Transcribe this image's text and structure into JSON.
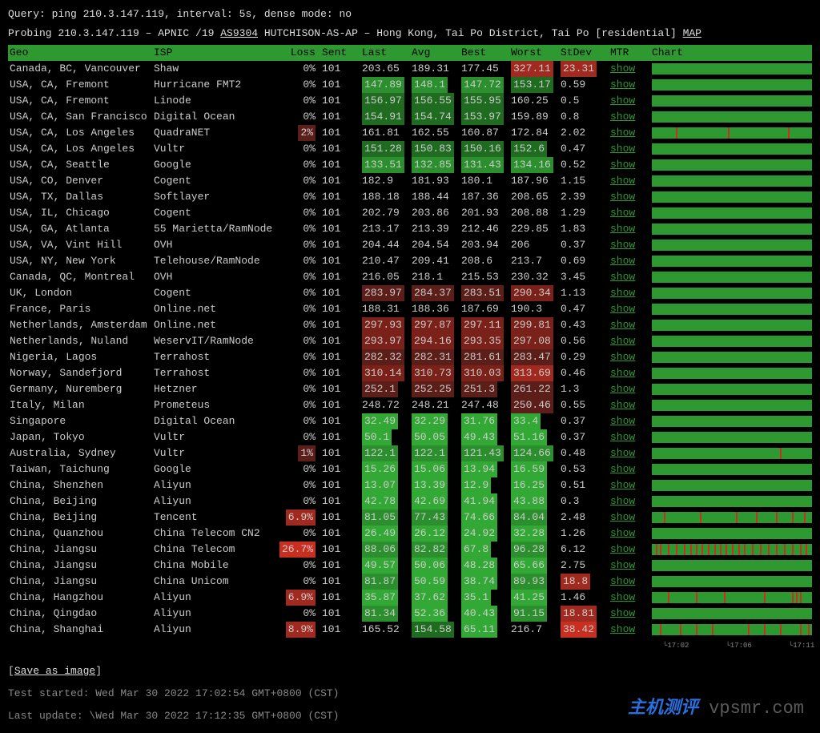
{
  "query_line": "Query: ping 210.3.147.119, interval: 5s, dense mode: no",
  "probe": {
    "prefix": "Probing 210.3.147.119 – APNIC /19 ",
    "asn": "AS9304",
    "mid": " HUTCHISON-AS-AP – Hong Kong, Tai Po District, Tai Po [residential] ",
    "map": "MAP"
  },
  "headers": {
    "geo": "Geo",
    "isp": "ISP",
    "loss": "Loss",
    "sent": "Sent",
    "last": "Last",
    "avg": "Avg",
    "best": "Best",
    "worst": "Worst",
    "stdev": "StDev",
    "mtr": "MTR",
    "chart": "Chart"
  },
  "mtr_label": "show",
  "rows": [
    {
      "geo": "Canada, BC, Vancouver",
      "isp": "Shaw",
      "loss": "0%",
      "lossc": "",
      "sent": "101",
      "last": "203.65",
      "lastc": "",
      "avg": "189.31",
      "avgc": "",
      "best": "177.45",
      "bestc": "",
      "worst": "327.11",
      "worstc": "r3",
      "stdev": "23.31",
      "stdevc": "r3",
      "ticks": []
    },
    {
      "geo": "USA, CA, Fremont",
      "isp": "Hurricane FMT2",
      "loss": "0%",
      "lossc": "",
      "sent": "101",
      "last": "147.89",
      "lastc": "g2",
      "avg": "148.1",
      "avgc": "g2",
      "best": "147.72",
      "bestc": "g2",
      "worst": "153.17",
      "worstc": "g1",
      "stdev": "0.59",
      "stdevc": "",
      "ticks": []
    },
    {
      "geo": "USA, CA, Fremont",
      "isp": "Linode",
      "loss": "0%",
      "lossc": "",
      "sent": "101",
      "last": "156.97",
      "lastc": "g1",
      "avg": "156.55",
      "avgc": "g1",
      "best": "155.95",
      "bestc": "g1",
      "worst": "160.25",
      "worstc": "",
      "stdev": "0.5",
      "stdevc": "",
      "ticks": []
    },
    {
      "geo": "USA, CA, San Francisco",
      "isp": "Digital Ocean",
      "loss": "0%",
      "lossc": "",
      "sent": "101",
      "last": "154.91",
      "lastc": "g1",
      "avg": "154.74",
      "avgc": "g1",
      "best": "153.97",
      "bestc": "g1",
      "worst": "159.89",
      "worstc": "",
      "stdev": "0.8",
      "stdevc": "",
      "ticks": []
    },
    {
      "geo": "USA, CA, Los Angeles",
      "isp": "QuadraNET",
      "loss": "2%",
      "lossc": "r1",
      "sent": "101",
      "last": "161.81",
      "lastc": "",
      "avg": "162.55",
      "avgc": "",
      "best": "160.87",
      "bestc": "",
      "worst": "172.84",
      "worstc": "",
      "stdev": "2.02",
      "stdevc": "",
      "ticks": [
        30,
        95,
        170
      ]
    },
    {
      "geo": "USA, CA, Los Angeles",
      "isp": "Vultr",
      "loss": "0%",
      "lossc": "",
      "sent": "101",
      "last": "151.28",
      "lastc": "g1",
      "avg": "150.83",
      "avgc": "g1",
      "best": "150.16",
      "bestc": "g1",
      "worst": "152.6",
      "worstc": "g1",
      "stdev": "0.47",
      "stdevc": "",
      "ticks": []
    },
    {
      "geo": "USA, CA, Seattle",
      "isp": "Google",
      "loss": "0%",
      "lossc": "",
      "sent": "101",
      "last": "133.51",
      "lastc": "g2",
      "avg": "132.85",
      "avgc": "g2",
      "best": "131.43",
      "bestc": "g2",
      "worst": "134.16",
      "worstc": "g2",
      "stdev": "0.52",
      "stdevc": "",
      "ticks": []
    },
    {
      "geo": "USA, CO, Denver",
      "isp": "Cogent",
      "loss": "0%",
      "lossc": "",
      "sent": "101",
      "last": "182.9",
      "lastc": "",
      "avg": "181.93",
      "avgc": "",
      "best": "180.1",
      "bestc": "",
      "worst": "187.96",
      "worstc": "",
      "stdev": "1.15",
      "stdevc": "",
      "ticks": []
    },
    {
      "geo": "USA, TX, Dallas",
      "isp": "Softlayer",
      "loss": "0%",
      "lossc": "",
      "sent": "101",
      "last": "188.18",
      "lastc": "",
      "avg": "188.44",
      "avgc": "",
      "best": "187.36",
      "bestc": "",
      "worst": "208.65",
      "worstc": "",
      "stdev": "2.39",
      "stdevc": "",
      "ticks": []
    },
    {
      "geo": "USA, IL, Chicago",
      "isp": "Cogent",
      "loss": "0%",
      "lossc": "",
      "sent": "101",
      "last": "202.79",
      "lastc": "",
      "avg": "203.86",
      "avgc": "",
      "best": "201.93",
      "bestc": "",
      "worst": "208.88",
      "worstc": "",
      "stdev": "1.29",
      "stdevc": "",
      "ticks": []
    },
    {
      "geo": "USA, GA, Atlanta",
      "isp": "55 Marietta/RamNode",
      "loss": "0%",
      "lossc": "",
      "sent": "101",
      "last": "213.17",
      "lastc": "",
      "avg": "213.39",
      "avgc": "",
      "best": "212.46",
      "bestc": "",
      "worst": "229.85",
      "worstc": "",
      "stdev": "1.83",
      "stdevc": "",
      "ticks": []
    },
    {
      "geo": "USA, VA, Vint Hill",
      "isp": "OVH",
      "loss": "0%",
      "lossc": "",
      "sent": "101",
      "last": "204.44",
      "lastc": "",
      "avg": "204.54",
      "avgc": "",
      "best": "203.94",
      "bestc": "",
      "worst": "206",
      "worstc": "",
      "stdev": "0.37",
      "stdevc": "",
      "ticks": []
    },
    {
      "geo": "USA, NY, New York",
      "isp": "Telehouse/RamNode",
      "loss": "0%",
      "lossc": "",
      "sent": "101",
      "last": "210.47",
      "lastc": "",
      "avg": "209.41",
      "avgc": "",
      "best": "208.6",
      "bestc": "",
      "worst": "213.7",
      "worstc": "",
      "stdev": "0.69",
      "stdevc": "",
      "ticks": []
    },
    {
      "geo": "Canada, QC, Montreal",
      "isp": "OVH",
      "loss": "0%",
      "lossc": "",
      "sent": "101",
      "last": "216.05",
      "lastc": "",
      "avg": "218.1",
      "avgc": "",
      "best": "215.53",
      "bestc": "",
      "worst": "230.32",
      "worstc": "",
      "stdev": "3.45",
      "stdevc": "",
      "ticks": []
    },
    {
      "geo": "UK, London",
      "isp": "Cogent",
      "loss": "0%",
      "lossc": "",
      "sent": "101",
      "last": "283.97",
      "lastc": "r1",
      "avg": "284.37",
      "avgc": "r1",
      "best": "283.51",
      "bestc": "r1",
      "worst": "290.34",
      "worstc": "r2",
      "stdev": "1.13",
      "stdevc": "",
      "ticks": []
    },
    {
      "geo": "France, Paris",
      "isp": "Online.net",
      "loss": "0%",
      "lossc": "",
      "sent": "101",
      "last": "188.31",
      "lastc": "",
      "avg": "188.36",
      "avgc": "",
      "best": "187.69",
      "bestc": "",
      "worst": "190.3",
      "worstc": "",
      "stdev": "0.47",
      "stdevc": "",
      "ticks": []
    },
    {
      "geo": "Netherlands, Amsterdam",
      "isp": "Online.net",
      "loss": "0%",
      "lossc": "",
      "sent": "101",
      "last": "297.93",
      "lastc": "r2",
      "avg": "297.87",
      "avgc": "r2",
      "best": "297.11",
      "bestc": "r2",
      "worst": "299.81",
      "worstc": "r2",
      "stdev": "0.43",
      "stdevc": "",
      "ticks": []
    },
    {
      "geo": "Netherlands, Nuland",
      "isp": "WeservIT/RamNode",
      "loss": "0%",
      "lossc": "",
      "sent": "101",
      "last": "293.97",
      "lastc": "r2",
      "avg": "294.16",
      "avgc": "r2",
      "best": "293.35",
      "bestc": "r2",
      "worst": "297.08",
      "worstc": "r2",
      "stdev": "0.56",
      "stdevc": "",
      "ticks": []
    },
    {
      "geo": "Nigeria, Lagos",
      "isp": "Terrahost",
      "loss": "0%",
      "lossc": "",
      "sent": "101",
      "last": "282.32",
      "lastc": "r1",
      "avg": "282.31",
      "avgc": "r1",
      "best": "281.61",
      "bestc": "r1",
      "worst": "283.47",
      "worstc": "r1",
      "stdev": "0.29",
      "stdevc": "",
      "ticks": []
    },
    {
      "geo": "Norway, Sandefjord",
      "isp": "Terrahost",
      "loss": "0%",
      "lossc": "",
      "sent": "101",
      "last": "310.14",
      "lastc": "r2",
      "avg": "310.73",
      "avgc": "r2",
      "best": "310.03",
      "bestc": "r2",
      "worst": "313.69",
      "worstc": "r3",
      "stdev": "0.46",
      "stdevc": "",
      "ticks": []
    },
    {
      "geo": "Germany, Nuremberg",
      "isp": "Hetzner",
      "loss": "0%",
      "lossc": "",
      "sent": "101",
      "last": "252.1",
      "lastc": "r1",
      "avg": "252.25",
      "avgc": "r1",
      "best": "251.3",
      "bestc": "r1",
      "worst": "261.22",
      "worstc": "r1",
      "stdev": "1.3",
      "stdevc": "",
      "ticks": []
    },
    {
      "geo": "Italy, Milan",
      "isp": "Prometeus",
      "loss": "0%",
      "lossc": "",
      "sent": "101",
      "last": "248.72",
      "lastc": "",
      "avg": "248.21",
      "avgc": "",
      "best": "247.48",
      "bestc": "",
      "worst": "250.46",
      "worstc": "r1",
      "stdev": "0.55",
      "stdevc": "",
      "ticks": []
    },
    {
      "geo": "Singapore",
      "isp": "Digital Ocean",
      "loss": "0%",
      "lossc": "",
      "sent": "101",
      "last": "32.49",
      "lastc": "g3",
      "avg": "32.29",
      "avgc": "g3",
      "best": "31.76",
      "bestc": "g3",
      "worst": "33.4",
      "worstc": "g3",
      "stdev": "0.37",
      "stdevc": "",
      "ticks": []
    },
    {
      "geo": "Japan, Tokyo",
      "isp": "Vultr",
      "loss": "0%",
      "lossc": "",
      "sent": "101",
      "last": "50.1",
      "lastc": "g3",
      "avg": "50.05",
      "avgc": "g3",
      "best": "49.43",
      "bestc": "g3",
      "worst": "51.16",
      "worstc": "g3",
      "stdev": "0.37",
      "stdevc": "",
      "ticks": []
    },
    {
      "geo": "Australia, Sydney",
      "isp": "Vultr",
      "loss": "1%",
      "lossc": "r1",
      "sent": "101",
      "last": "122.1",
      "lastc": "g2",
      "avg": "122.1",
      "avgc": "g2",
      "best": "121.43",
      "bestc": "g2",
      "worst": "124.66",
      "worstc": "g2",
      "stdev": "0.48",
      "stdevc": "",
      "ticks": [
        160
      ]
    },
    {
      "geo": "Taiwan, Taichung",
      "isp": "Google",
      "loss": "0%",
      "lossc": "",
      "sent": "101",
      "last": "15.26",
      "lastc": "g3",
      "avg": "15.06",
      "avgc": "g3",
      "best": "13.94",
      "bestc": "g3",
      "worst": "16.59",
      "worstc": "g3",
      "stdev": "0.53",
      "stdevc": "",
      "ticks": []
    },
    {
      "geo": "China, Shenzhen",
      "isp": "Aliyun",
      "loss": "0%",
      "lossc": "",
      "sent": "101",
      "last": "13.07",
      "lastc": "g3",
      "avg": "13.39",
      "avgc": "g3",
      "best": "12.9",
      "bestc": "g3",
      "worst": "16.25",
      "worstc": "g3",
      "stdev": "0.51",
      "stdevc": "",
      "ticks": []
    },
    {
      "geo": "China, Beijing",
      "isp": "Aliyun",
      "loss": "0%",
      "lossc": "",
      "sent": "101",
      "last": "42.78",
      "lastc": "g3",
      "avg": "42.69",
      "avgc": "g3",
      "best": "41.94",
      "bestc": "g3",
      "worst": "43.88",
      "worstc": "g3",
      "stdev": "0.3",
      "stdevc": "",
      "ticks": []
    },
    {
      "geo": "China, Beijing",
      "isp": "Tencent",
      "loss": "6.9%",
      "lossc": "r3",
      "sent": "101",
      "last": "81.05",
      "lastc": "g2",
      "avg": "77.43",
      "avgc": "g2",
      "best": "74.66",
      "bestc": "g3",
      "worst": "84.04",
      "worstc": "g2",
      "stdev": "2.48",
      "stdevc": "",
      "ticks": [
        15,
        60,
        105,
        130,
        155,
        175,
        190
      ]
    },
    {
      "geo": "China, Quanzhou",
      "isp": "China Telecom CN2",
      "loss": "0%",
      "lossc": "",
      "sent": "101",
      "last": "26.49",
      "lastc": "g3",
      "avg": "26.12",
      "avgc": "g3",
      "best": "24.92",
      "bestc": "g3",
      "worst": "32.28",
      "worstc": "g3",
      "stdev": "1.26",
      "stdevc": "",
      "ticks": []
    },
    {
      "geo": "China, Jiangsu",
      "isp": "China Telecom",
      "loss": "26.7%",
      "lossc": "r4",
      "sent": "101",
      "last": "88.06",
      "lastc": "g2",
      "avg": "82.82",
      "avgc": "g2",
      "best": "67.8",
      "bestc": "g3",
      "worst": "96.28",
      "worstc": "g2",
      "stdev": "6.12",
      "stdevc": "",
      "ticks": [
        5,
        10,
        20,
        30,
        40,
        48,
        55,
        62,
        70,
        78,
        85,
        92,
        100,
        108,
        115,
        125,
        135,
        145,
        155,
        165,
        175,
        185,
        192
      ]
    },
    {
      "geo": "China, Jiangsu",
      "isp": "China Mobile",
      "loss": "0%",
      "lossc": "",
      "sent": "101",
      "last": "49.57",
      "lastc": "g3",
      "avg": "50.06",
      "avgc": "g3",
      "best": "48.28",
      "bestc": "g3",
      "worst": "65.66",
      "worstc": "g3",
      "stdev": "2.75",
      "stdevc": "",
      "ticks": []
    },
    {
      "geo": "China, Jiangsu",
      "isp": "China Unicom",
      "loss": "0%",
      "lossc": "",
      "sent": "101",
      "last": "81.87",
      "lastc": "g2",
      "avg": "50.59",
      "avgc": "g3",
      "best": "38.74",
      "bestc": "g3",
      "worst": "89.93",
      "worstc": "g2",
      "stdev": "18.8",
      "stdevc": "r3",
      "ticks": []
    },
    {
      "geo": "China, Hangzhou",
      "isp": "Aliyun",
      "loss": "6.9%",
      "lossc": "r3",
      "sent": "101",
      "last": "35.87",
      "lastc": "g3",
      "avg": "37.62",
      "avgc": "g3",
      "best": "35.1",
      "bestc": "g3",
      "worst": "41.25",
      "worstc": "g3",
      "stdev": "1.46",
      "stdevc": "",
      "ticks": [
        20,
        55,
        90,
        140,
        175,
        180,
        185
      ]
    },
    {
      "geo": "China, Qingdao",
      "isp": "Aliyun",
      "loss": "0%",
      "lossc": "",
      "sent": "101",
      "last": "81.34",
      "lastc": "g2",
      "avg": "52.36",
      "avgc": "g3",
      "best": "40.43",
      "bestc": "g3",
      "worst": "91.15",
      "worstc": "g2",
      "stdev": "18.81",
      "stdevc": "r3",
      "ticks": []
    },
    {
      "geo": "China, Shanghai",
      "isp": "Aliyun",
      "loss": "8.9%",
      "lossc": "r3",
      "sent": "101",
      "last": "165.52",
      "lastc": "",
      "avg": "154.58",
      "avgc": "g1",
      "best": "65.11",
      "bestc": "g3",
      "worst": "216.7",
      "worstc": "",
      "stdev": "38.42",
      "stdevc": "r4",
      "ticks": [
        10,
        35,
        55,
        75,
        120,
        140,
        160,
        185,
        195
      ]
    }
  ],
  "axis_labels": [
    "17:02",
    "17:06",
    "17:11"
  ],
  "save": "Save as image",
  "started": "Test started: Wed Mar 30 2022 17:02:54 GMT+0800 (CST)",
  "updated": "Last update: \\Wed Mar 30 2022 17:12:35 GMT+0800 (CST)",
  "watermark": {
    "cn": "主机测评",
    "dom": "vpsmr.com"
  }
}
